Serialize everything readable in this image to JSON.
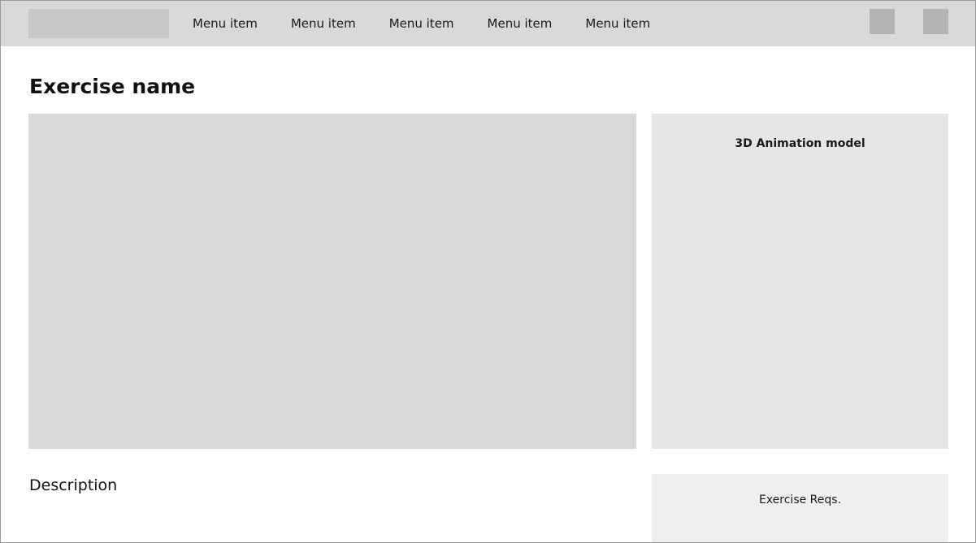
{
  "navbar": {
    "menu_items": [
      {
        "label": "Menu item"
      },
      {
        "label": "Menu item"
      },
      {
        "label": "Menu item"
      },
      {
        "label": "Menu item"
      },
      {
        "label": "Menu item"
      }
    ]
  },
  "main": {
    "title": "Exercise name",
    "model_panel": {
      "label": "3D Animation model"
    },
    "description_label": "Description",
    "requirements_panel": {
      "label": "Exercise Reqs."
    }
  },
  "colors": {
    "navbar_bg": "#d9d9d9",
    "placeholder_gray": "#d9d9d9",
    "panel_gray": "#e6e6e6",
    "icon_gray": "#b4b4b4"
  }
}
